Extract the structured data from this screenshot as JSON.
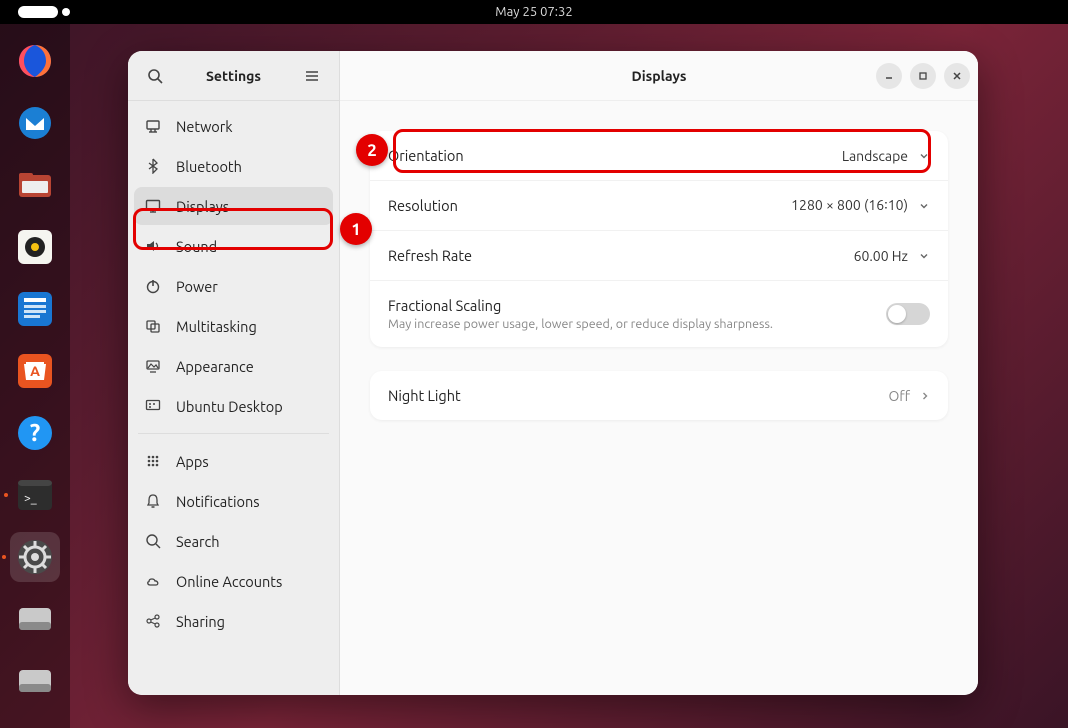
{
  "topbar": {
    "datetime": "May 25  07:32"
  },
  "dock": {
    "apps": [
      "firefox",
      "thunderbird",
      "files",
      "rhythmbox",
      "writer",
      "software",
      "help",
      "terminal",
      "settings",
      "disk1",
      "disk2"
    ],
    "active": "settings"
  },
  "window": {
    "sidebar": {
      "title": "Settings",
      "items": [
        {
          "id": "network",
          "label": "Network"
        },
        {
          "id": "bluetooth",
          "label": "Bluetooth"
        },
        {
          "id": "displays",
          "label": "Displays",
          "selected": true
        },
        {
          "id": "sound",
          "label": "Sound"
        },
        {
          "id": "power",
          "label": "Power"
        },
        {
          "id": "multitasking",
          "label": "Multitasking"
        },
        {
          "id": "appearance",
          "label": "Appearance"
        },
        {
          "id": "ubuntu-desktop",
          "label": "Ubuntu Desktop"
        },
        {
          "sep": true
        },
        {
          "id": "apps",
          "label": "Apps"
        },
        {
          "id": "notifications",
          "label": "Notifications"
        },
        {
          "id": "search",
          "label": "Search"
        },
        {
          "id": "online-accounts",
          "label": "Online Accounts"
        },
        {
          "id": "sharing",
          "label": "Sharing"
        }
      ]
    },
    "content": {
      "title": "Displays",
      "rows": {
        "orientation": {
          "label": "Orientation",
          "value": "Landscape"
        },
        "resolution": {
          "label": "Resolution",
          "value": "1280 × 800 (16∶10)"
        },
        "refresh": {
          "label": "Refresh Rate",
          "value": "60.00 Hz"
        },
        "fractional": {
          "label": "Fractional Scaling",
          "sub": "May increase power usage, lower speed, or reduce display sharpness.",
          "on": false
        },
        "nightlight": {
          "label": "Night Light",
          "value": "Off"
        }
      }
    }
  },
  "callouts": {
    "1": "1",
    "2": "2"
  }
}
